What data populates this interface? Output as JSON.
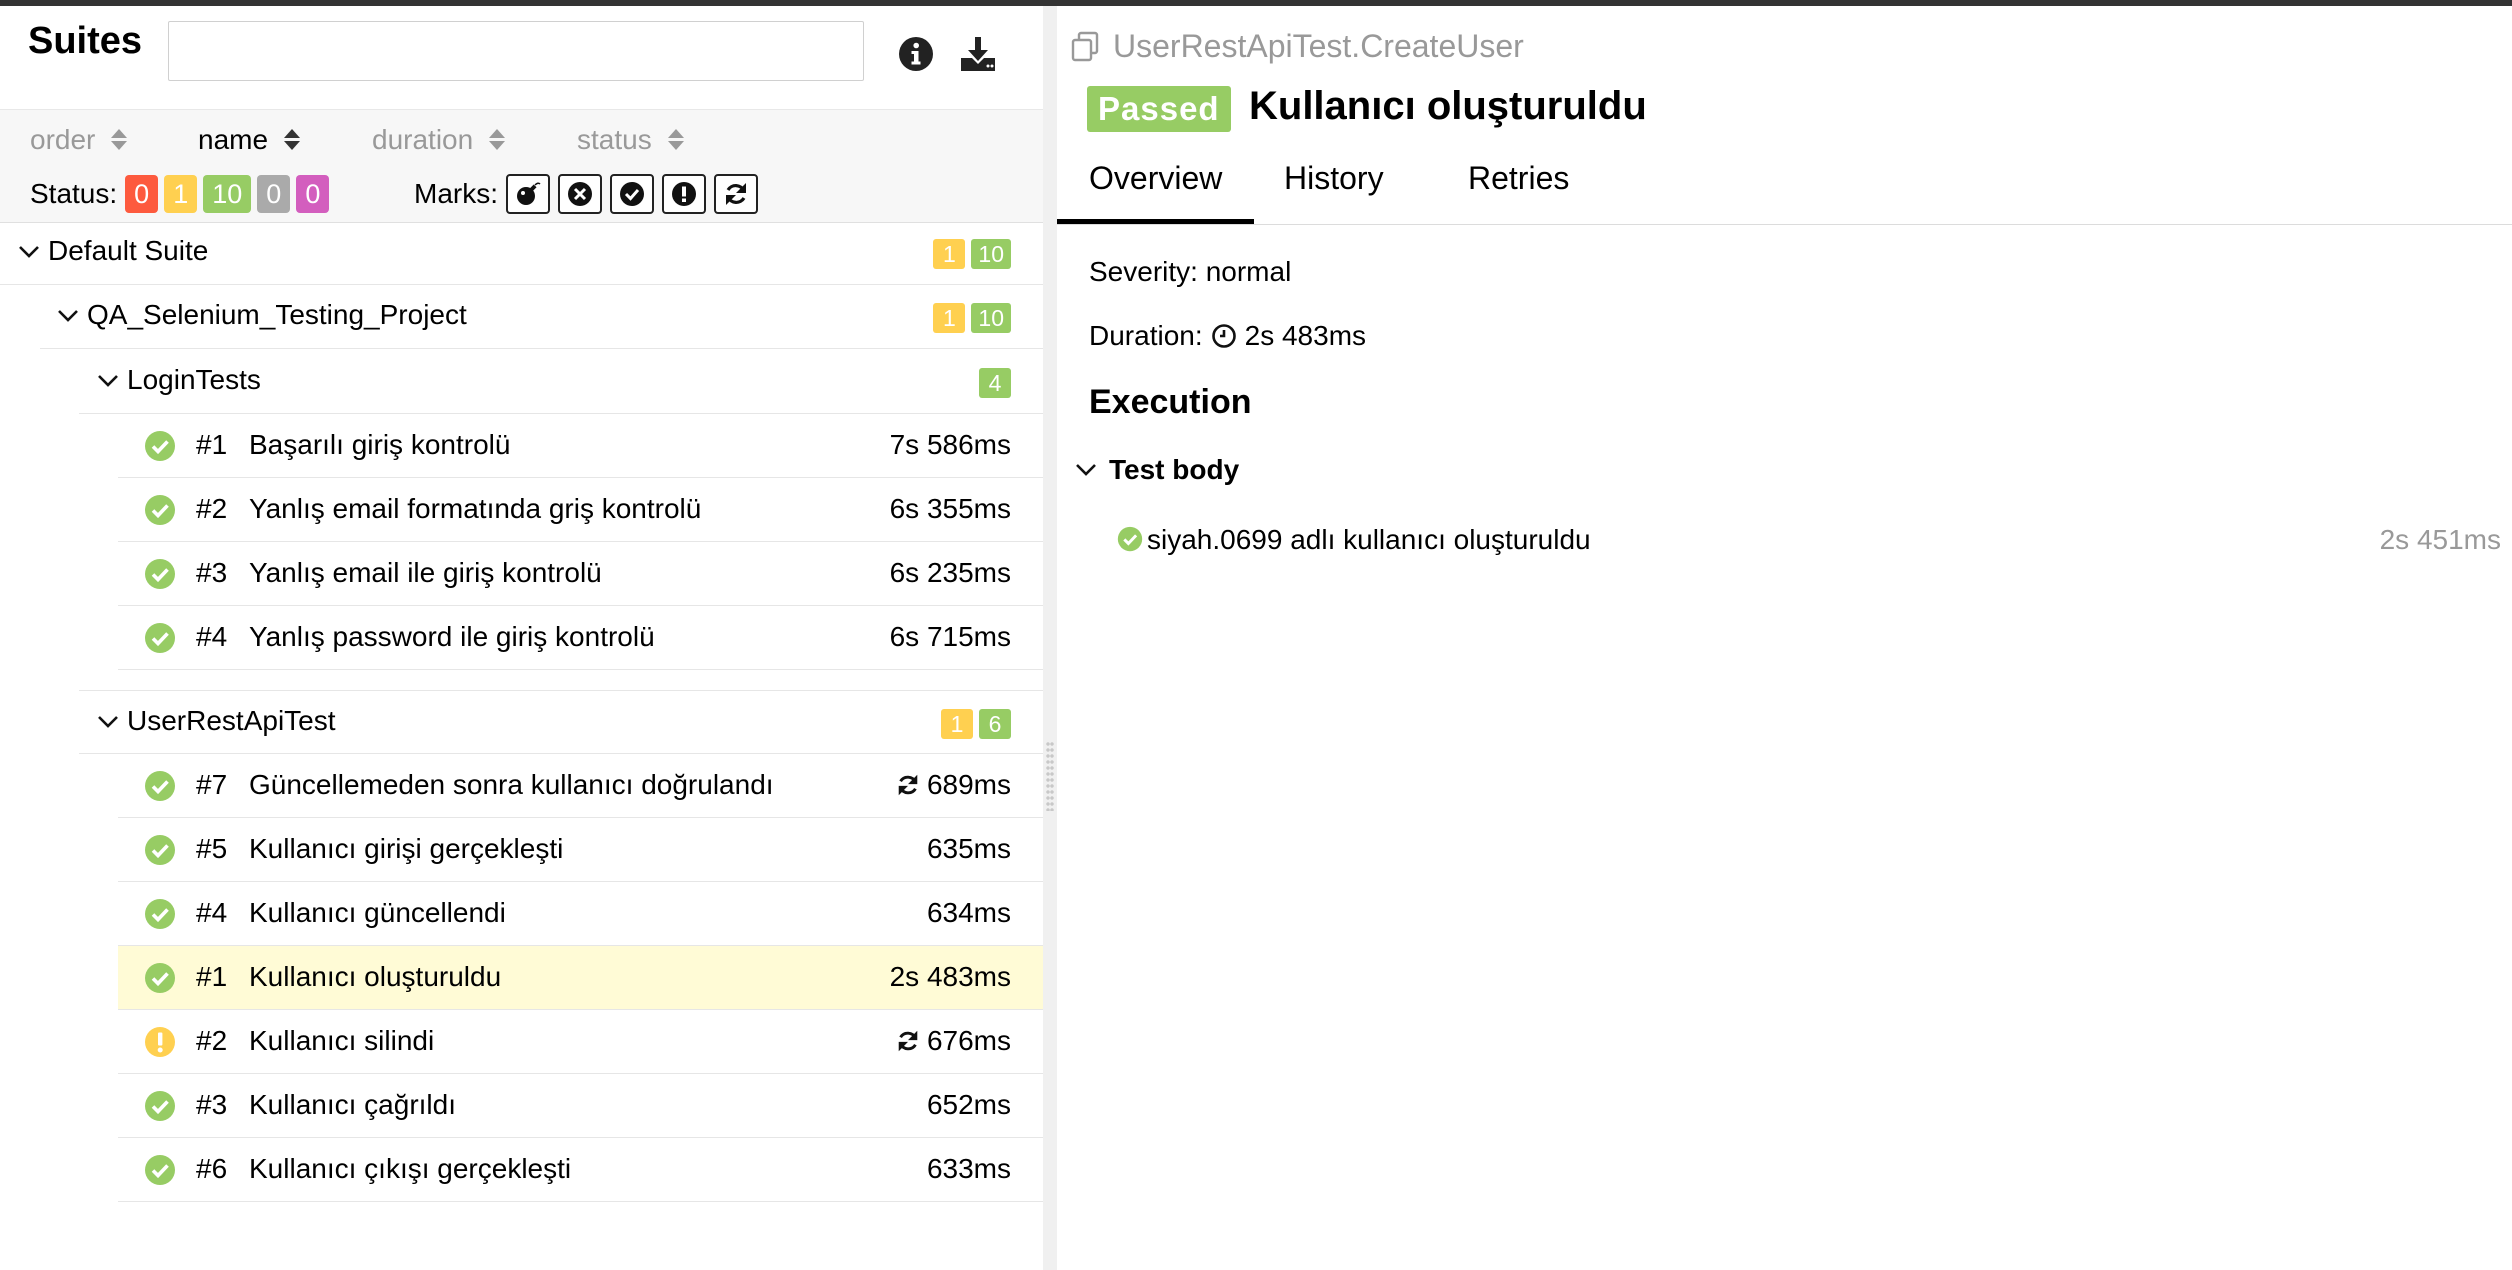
{
  "left": {
    "title": "Suites",
    "search": {
      "value": "",
      "placeholder": ""
    },
    "sort": [
      "order",
      "name",
      "duration",
      "status"
    ],
    "status_label": "Status:",
    "status_counts": [
      {
        "status": "failed",
        "value": "0",
        "color": "#fd5a3e"
      },
      {
        "status": "broken",
        "value": "1",
        "color": "#ffd050"
      },
      {
        "status": "passed",
        "value": "10",
        "color": "#97cc64"
      },
      {
        "status": "skipped",
        "value": "0",
        "color": "#aaaaaa"
      },
      {
        "status": "unknown",
        "value": "0",
        "color": "#d35ebe"
      }
    ],
    "marks_label": "Marks:",
    "marks_icons": [
      "bomb-icon",
      "times-circle-icon",
      "check-circle-icon",
      "exclamation-icon",
      "refresh-icon"
    ],
    "groups": {
      "default_suite": {
        "name": "Default Suite",
        "broken": "1",
        "passed": "10"
      },
      "project": {
        "name": "QA_Selenium_Testing_Project",
        "broken": "1",
        "passed": "10"
      },
      "login_tests": {
        "name": "LoginTests",
        "passed": "4",
        "tests": [
          {
            "num": "#1",
            "name": "Başarılı giriş kontrolü",
            "duration": "7s 586ms",
            "status": "passed",
            "retry": false
          },
          {
            "num": "#2",
            "name": "Yanlış email formatında griş kontrolü",
            "duration": "6s 355ms",
            "status": "passed",
            "retry": false
          },
          {
            "num": "#3",
            "name": "Yanlış email ile giriş kontrolü",
            "duration": "6s 235ms",
            "status": "passed",
            "retry": false
          },
          {
            "num": "#4",
            "name": "Yanlış password ile giriş kontrolü",
            "duration": "6s 715ms",
            "status": "passed",
            "retry": false
          }
        ]
      },
      "user_rest_api": {
        "name": "UserRestApiTest",
        "broken": "1",
        "passed": "6",
        "tests": [
          {
            "num": "#7",
            "name": "Güncellemeden sonra kullanıcı doğrulandı",
            "duration": "689ms",
            "status": "passed",
            "retry": true
          },
          {
            "num": "#5",
            "name": "Kullanıcı girişi gerçekleşti",
            "duration": "635ms",
            "status": "passed",
            "retry": false
          },
          {
            "num": "#4",
            "name": "Kullanıcı güncellendi",
            "duration": "634ms",
            "status": "passed",
            "retry": false
          },
          {
            "num": "#1",
            "name": "Kullanıcı oluşturuldu",
            "duration": "2s 483ms",
            "status": "passed",
            "retry": false,
            "selected": true
          },
          {
            "num": "#2",
            "name": "Kullanıcı silindi",
            "duration": "676ms",
            "status": "broken",
            "retry": true
          },
          {
            "num": "#3",
            "name": "Kullanıcı çağrıldı",
            "duration": "652ms",
            "status": "passed",
            "retry": false
          },
          {
            "num": "#6",
            "name": "Kullanıcı çıkışı gerçekleşti",
            "duration": "633ms",
            "status": "passed",
            "retry": false
          }
        ]
      }
    }
  },
  "right": {
    "breadcrumb": "UserRestApiTest.CreateUser",
    "status": "Passed",
    "status_color": "#97cc64",
    "title": "Kullanıcı oluşturuldu",
    "tabs": [
      "Overview",
      "History",
      "Retries"
    ],
    "active_tab": "Overview",
    "severity_label": "Severity: normal",
    "duration_label": "Duration:",
    "duration_value": "2s 483ms",
    "execution_title": "Execution",
    "test_body_label": "Test body",
    "steps": [
      {
        "name": "siyah.0699 adlı kullanıcı oluşturuldu",
        "duration": "2s 451ms",
        "status": "passed"
      }
    ]
  }
}
